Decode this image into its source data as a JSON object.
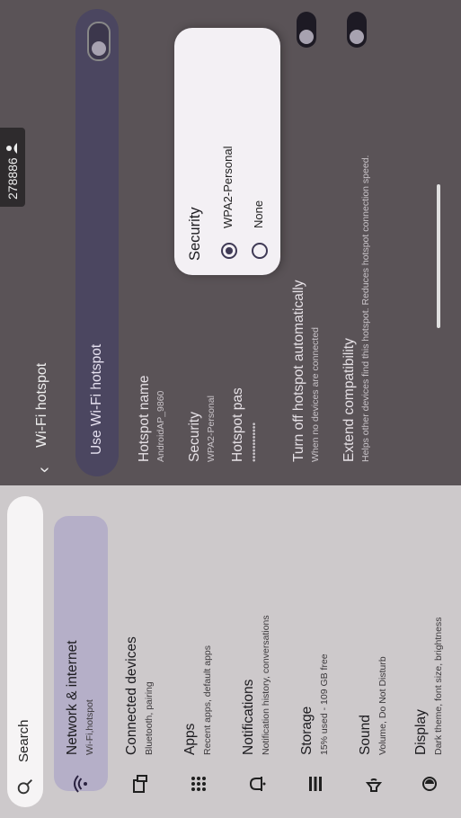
{
  "status": {
    "time": "278886"
  },
  "search": {
    "placeholder": "Search"
  },
  "sidebar": {
    "items": [
      {
        "title": "Network & internet",
        "subtitle": "Wi-Fi,hotspot",
        "icon": "wifi-icon",
        "selected": true
      },
      {
        "title": "Connected devices",
        "subtitle": "Bluetooth, pairing",
        "icon": "devices-icon"
      },
      {
        "title": "Apps",
        "subtitle": "Recent apps, default apps",
        "icon": "apps-grid-icon"
      },
      {
        "title": "Notifications",
        "subtitle": "Notification history, conversations",
        "icon": "bell-icon"
      },
      {
        "title": "Storage",
        "subtitle": "15% used - 109 GB free",
        "icon": "storage-icon"
      },
      {
        "title": "Sound",
        "subtitle": "Volume, Do Not Disturb",
        "icon": "speaker-icon"
      },
      {
        "title": "Display",
        "subtitle": "Dark theme, font size, brightness",
        "icon": "brightness-icon"
      }
    ]
  },
  "hotspot": {
    "title": "Wi-Fi hotspot",
    "use_label": "Use Wi-Fi hotspot",
    "rows": [
      {
        "title": "Hotspot name",
        "subtitle": "AndroidAP_9860"
      },
      {
        "title": "Security",
        "subtitle": "WPA2-Personal"
      },
      {
        "title": "Hotspot pas",
        "subtitle": "••••••••••••"
      },
      {
        "title": "Turn off hotspot automatically",
        "subtitle": "When no devices are connected"
      },
      {
        "title": "Extend compatibility",
        "subtitle": "Helps other devices find this hotspot. Reduces hotspot connection speed."
      }
    ]
  },
  "dialog": {
    "title": "Security",
    "options": [
      {
        "label": "WPA2-Personal",
        "selected": true
      },
      {
        "label": "None",
        "selected": false
      }
    ]
  },
  "colors": {
    "accent": "#3f3a55",
    "selected_bg": "#b5afc8"
  }
}
